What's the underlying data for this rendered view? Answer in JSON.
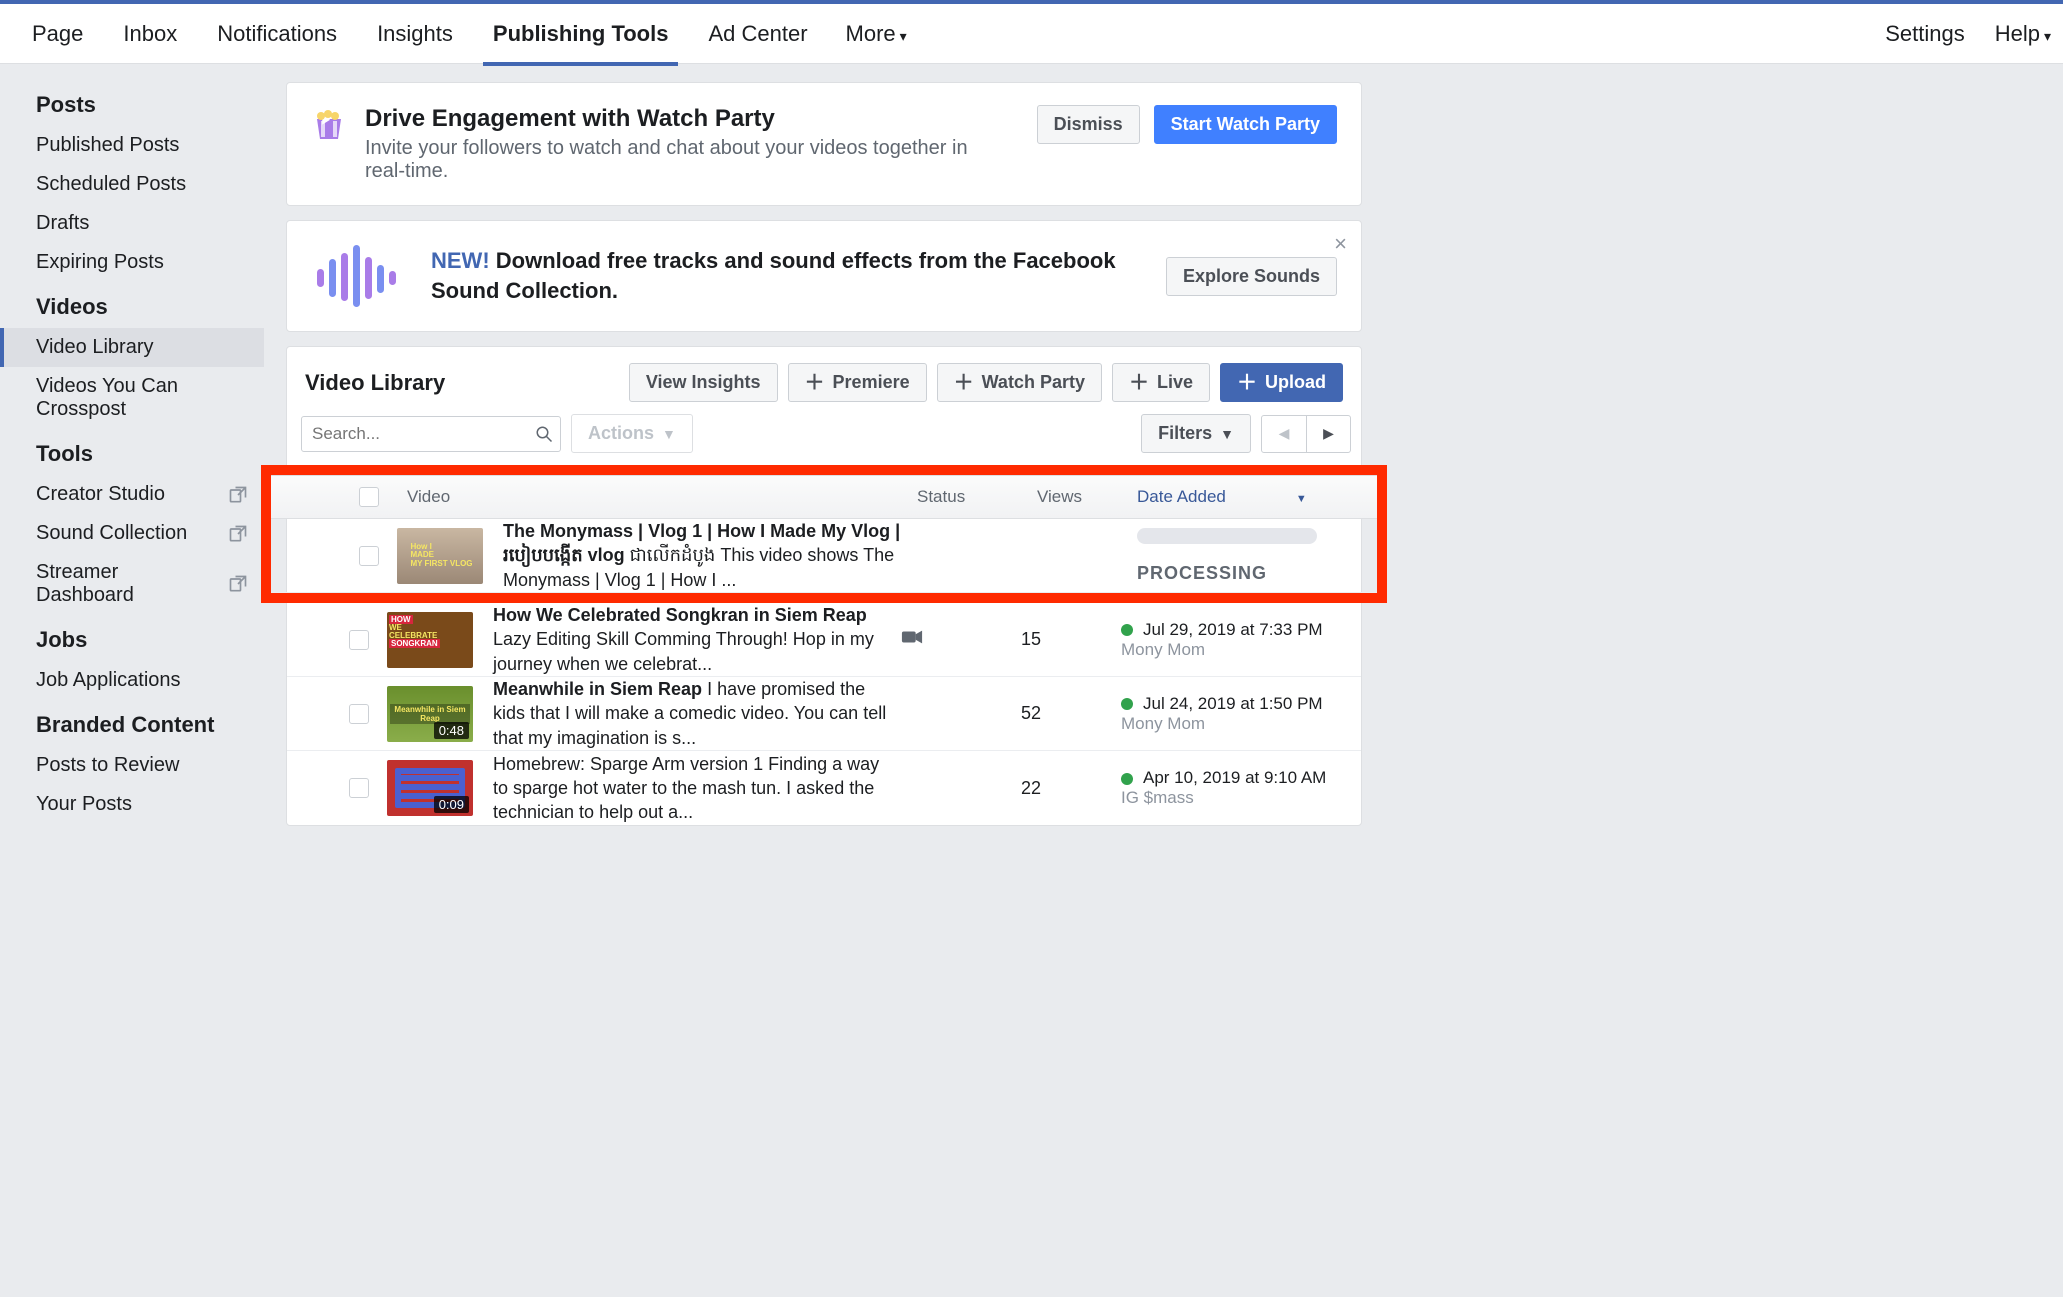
{
  "topnav": {
    "tabs": [
      {
        "label": "Page"
      },
      {
        "label": "Inbox"
      },
      {
        "label": "Notifications"
      },
      {
        "label": "Insights"
      },
      {
        "label": "Publishing Tools",
        "active": true
      },
      {
        "label": "Ad Center"
      }
    ],
    "more": "More",
    "settings": "Settings",
    "help": "Help"
  },
  "sidebar": {
    "groups": [
      {
        "title": "Posts",
        "items": [
          {
            "label": "Published Posts"
          },
          {
            "label": "Scheduled Posts"
          },
          {
            "label": "Drafts"
          },
          {
            "label": "Expiring Posts"
          }
        ]
      },
      {
        "title": "Videos",
        "items": [
          {
            "label": "Video Library",
            "active": true
          },
          {
            "label": "Videos You Can Crosspost"
          }
        ]
      },
      {
        "title": "Tools",
        "items": [
          {
            "label": "Creator Studio",
            "ext": true
          },
          {
            "label": "Sound Collection",
            "ext": true
          },
          {
            "label": "Streamer Dashboard",
            "ext": true
          }
        ]
      },
      {
        "title": "Jobs",
        "items": [
          {
            "label": "Job Applications"
          }
        ]
      },
      {
        "title": "Branded Content",
        "items": [
          {
            "label": "Posts to Review"
          },
          {
            "label": "Your Posts"
          }
        ]
      }
    ]
  },
  "watch_party": {
    "title": "Drive Engagement with Watch Party",
    "subtitle": "Invite your followers to watch and chat about your videos together in real-time.",
    "dismiss": "Dismiss",
    "start": "Start Watch Party"
  },
  "sound_banner": {
    "new": "NEW!",
    "text": "Download free tracks and sound effects from the Facebook Sound Collection.",
    "button": "Explore Sounds"
  },
  "video_library": {
    "title": "Video Library",
    "buttons": {
      "view_insights": "View Insights",
      "premiere": "Premiere",
      "watch_party": "Watch Party",
      "live": "Live",
      "upload": "Upload"
    },
    "search_placeholder": "Search...",
    "actions": "Actions",
    "filters": "Filters",
    "columns": {
      "video": "Video",
      "status": "Status",
      "views": "Views",
      "date_added": "Date Added"
    },
    "processing_label": "PROCESSING",
    "rows": [
      {
        "title": "The Monymass | Vlog 1 | How I Made My Vlog | ",
        "title_tail": "របៀបបង្កើត vlog",
        "desc": " ជាលើកដំបូង This video shows The Monymass | Vlog 1 | How I ...",
        "views": "",
        "date": "",
        "author": "",
        "processing": true,
        "duration": ""
      },
      {
        "title": "How We Celebrated Songkran in Siem Reap",
        "desc": " Lazy Editing Skill Comming Through! Hop in my journey when we celebrat...",
        "views": "15",
        "date": "Jul 29, 2019 at 7:33 PM",
        "author": "Mony Mom",
        "status_icon": true,
        "duration": ""
      },
      {
        "title": "Meanwhile in Siem Reap",
        "desc": " I have promised the kids that I will make a comedic video. You can tell that my imagination is s...",
        "views": "52",
        "date": "Jul 24, 2019 at 1:50 PM",
        "author": "Mony Mom",
        "duration": "0:48"
      },
      {
        "title": "",
        "desc": "Homebrew: Sparge Arm version 1 Finding a way to sparge hot water to the mash tun. I asked the technician to help out a...",
        "views": "22",
        "date": "Apr 10, 2019 at 9:10 AM",
        "author": "IG $mass",
        "duration": "0:09"
      }
    ]
  }
}
